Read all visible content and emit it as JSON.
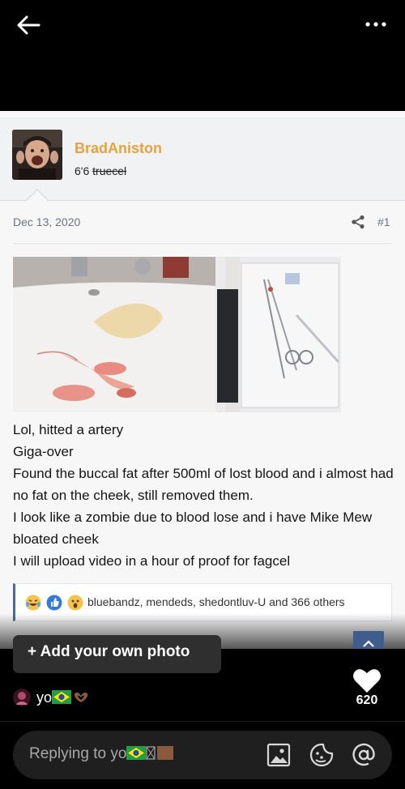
{
  "topbar": {
    "back": "back-arrow-icon",
    "more": "more-options-icon"
  },
  "post": {
    "username": "BradAniston",
    "usertitle_prefix": "6'6",
    "usertitle_strike": "truecel",
    "date": "Dec 13, 2020",
    "post_number": "#1",
    "body_lines": [
      "Lol, hitted a artery",
      "Giga-over",
      "Found the buccal fat after 500ml of lost blood and i almost had no fat on the cheek, still removed them.",
      "I look like a zombie due to blood lose and i have Mike Mew bloated cheek",
      "I will upload video in a hour of proof for fagcel"
    ],
    "reactions_text": "bluebandz, mendeds, shedontluv-U and 366 others",
    "reaction_icons": [
      "laugh-cry-icon",
      "like-icon",
      "wow-icon"
    ]
  },
  "overlay": {
    "add_photo": "+ Add your own photo",
    "like_count": "620",
    "blog_name": "yo",
    "reply_placeholder": "Replying to yo",
    "reply_icons": [
      "image-icon",
      "sticker-icon",
      "mention-icon"
    ]
  },
  "colors": {
    "username": "#e9a23b",
    "accent": "#4a6b9a",
    "background": "#000000"
  }
}
